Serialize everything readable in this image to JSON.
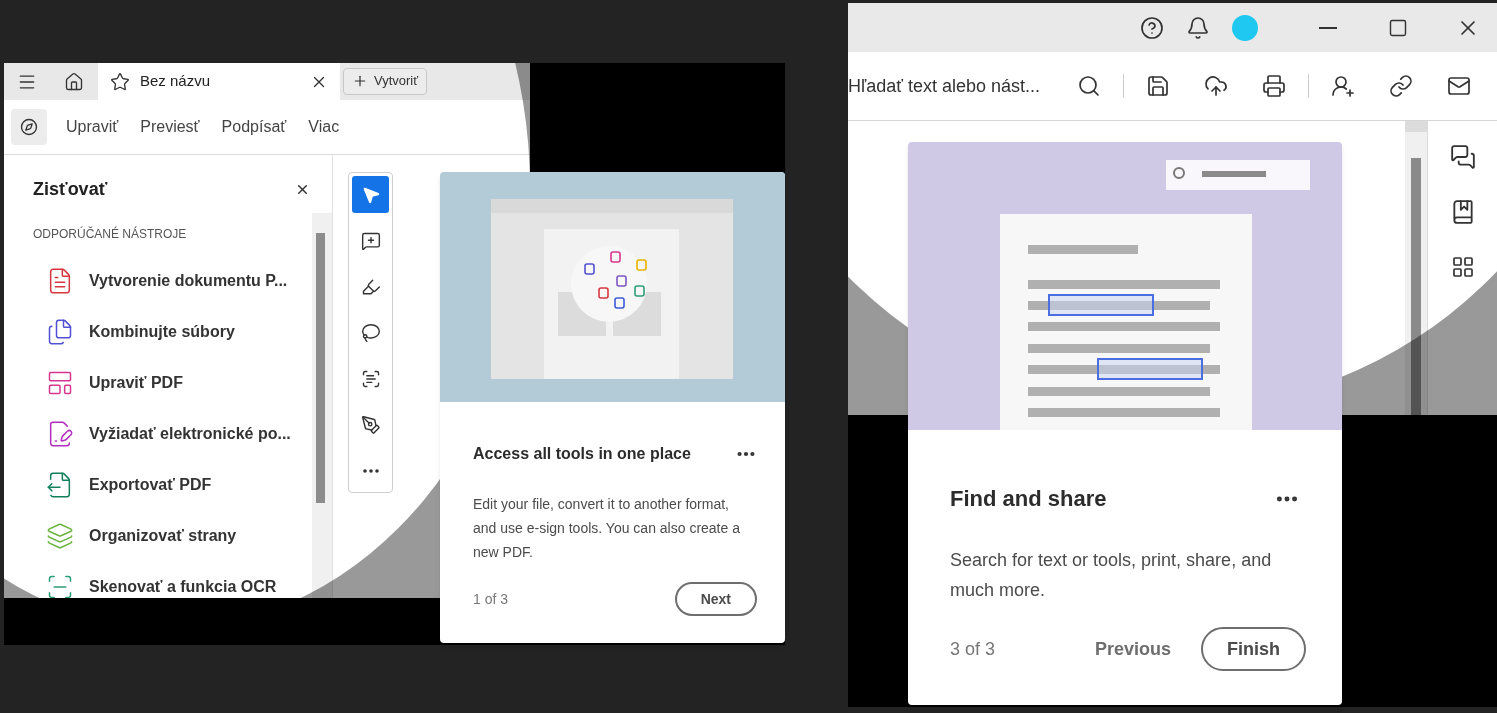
{
  "left_window": {
    "tab": {
      "title": "Bez názvu"
    },
    "create_button": "Vytvoriť",
    "menu": [
      {
        "label": "Upraviť"
      },
      {
        "label": "Previesť"
      },
      {
        "label": "Podpísať"
      },
      {
        "label": "Viac"
      }
    ],
    "panel": {
      "title": "Zisťovať",
      "section": "ODPORÚČANÉ NÁSTROJE",
      "tools": [
        {
          "kind": "create",
          "label": "Vytvorenie dokumentu P...",
          "color": "#d7373f"
        },
        {
          "kind": "combine",
          "label": "Kombinujte súbory",
          "color": "#5151d3"
        },
        {
          "kind": "edit",
          "label": "Upraviť PDF",
          "color": "#d83790"
        },
        {
          "kind": "request",
          "label": "Vyžiadať elektronické po...",
          "color": "#b130bd"
        },
        {
          "kind": "export",
          "label": "Exportovať PDF",
          "color": "#12805c"
        },
        {
          "kind": "organize",
          "label": "Organizovať strany",
          "color": "#6bb33d"
        },
        {
          "kind": "scan",
          "label": "Skenovať a funkcia OCR",
          "color": "#2d9d78"
        }
      ]
    },
    "tools": [
      {
        "kind": "select",
        "selected": true
      },
      {
        "kind": "comment",
        "selected": false
      },
      {
        "kind": "highlight",
        "selected": false
      },
      {
        "kind": "draw",
        "selected": false
      },
      {
        "kind": "text",
        "selected": false
      },
      {
        "kind": "sign",
        "selected": false
      },
      {
        "kind": "more",
        "selected": false
      }
    ],
    "card": {
      "title": "Access all tools in one place",
      "body": "Edit your file, convert it to another format, and use e-sign tools. You can also create a new PDF.",
      "progress": "1 of 3",
      "buttons": [
        {
          "kind": "outline",
          "label": "Next"
        }
      ]
    }
  },
  "right_window": {
    "search": {
      "placeholder": "Hľadať text alebo nást..."
    },
    "card": {
      "title": "Find and share",
      "body": "Search for text or tools, print, share, and much more.",
      "progress": "3 of 3",
      "buttons": [
        {
          "kind": "text",
          "label": "Previous"
        },
        {
          "kind": "outline",
          "label": "Finish"
        }
      ]
    }
  }
}
